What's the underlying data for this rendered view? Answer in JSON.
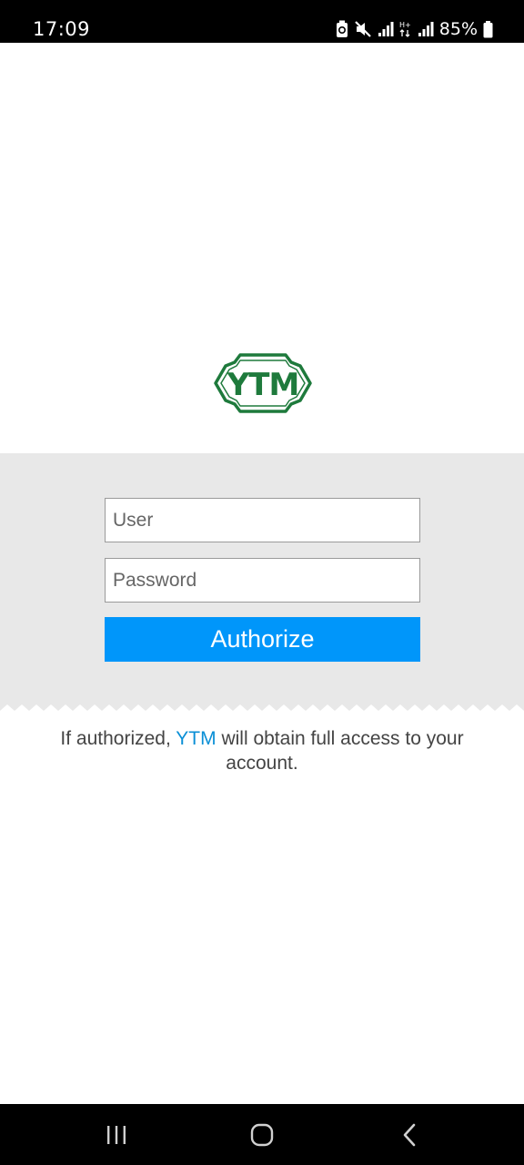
{
  "status_bar": {
    "time": "17:09",
    "battery": "85%",
    "icons": [
      "battery-saver-icon",
      "mute-icon",
      "signal-icon",
      "hplus-data-icon",
      "signal-icon",
      "battery-icon"
    ]
  },
  "logo": {
    "text": "YTM",
    "color": "#1e7a3c"
  },
  "login_form": {
    "user_placeholder": "User",
    "user_value": "",
    "password_placeholder": "Password",
    "password_value": "",
    "authorize_label": "Authorize",
    "button_color": "#0096fa",
    "panel_color": "#e8e8e8"
  },
  "notice": {
    "prefix": "If authorized, ",
    "brand": "YTM",
    "suffix": " will obtain full access to your account.",
    "brand_color": "#0a8fd6"
  },
  "nav_bar": {
    "icons": [
      "recents-icon",
      "home-icon",
      "back-icon"
    ]
  }
}
